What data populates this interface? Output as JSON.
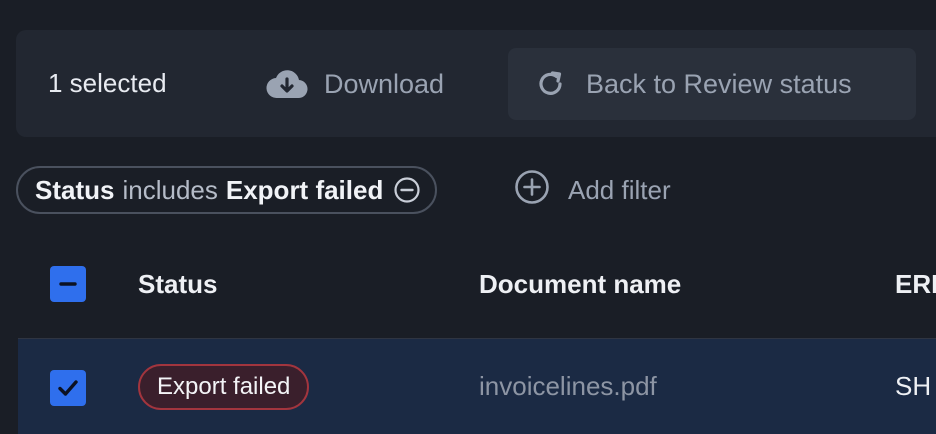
{
  "toolbar": {
    "selected_label": "1 selected",
    "download_label": "Download",
    "back_label": "Back to Review status"
  },
  "filters": {
    "active": {
      "field": "Status",
      "operator": "includes",
      "value": "Export failed"
    },
    "add_label": "Add filter"
  },
  "table": {
    "columns": [
      "Status",
      "Document name",
      "ERI"
    ],
    "rows": [
      {
        "selected": true,
        "status": "Export failed",
        "document_name": "invoicelines.pdf",
        "eri": "SH"
      }
    ]
  },
  "colors": {
    "accent": "#2f6fed",
    "error_border": "#a2353e",
    "error_bg": "#3a1f2c",
    "selected_row": "#1b2a44"
  }
}
